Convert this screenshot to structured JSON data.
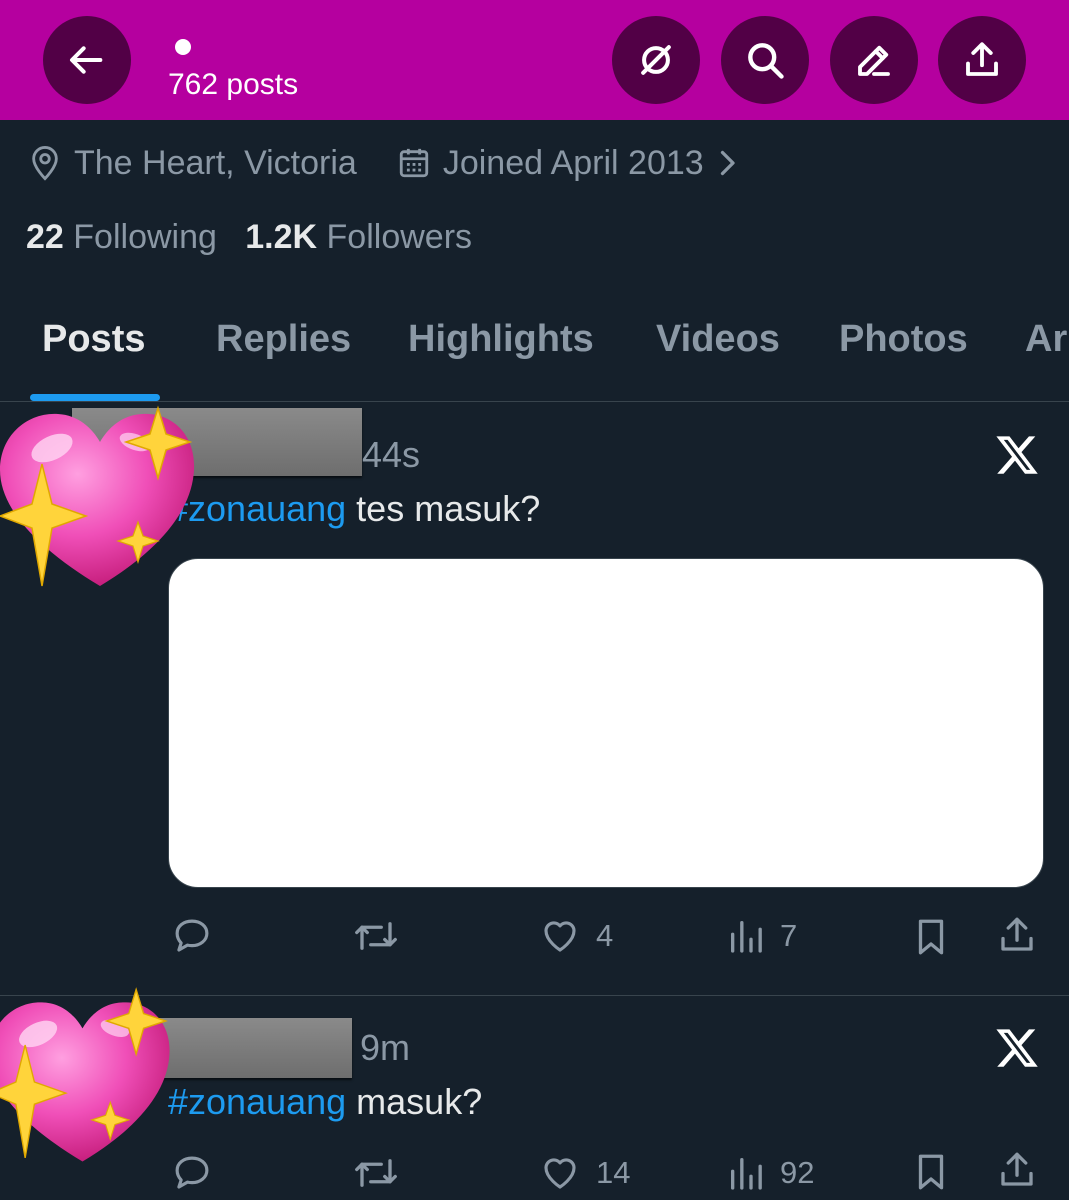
{
  "header": {
    "post_count": "762 posts",
    "icons": [
      "back-arrow-icon",
      "grok-icon",
      "search-icon",
      "edit-icon",
      "share-icon"
    ]
  },
  "profile": {
    "location": "The Heart, Victoria",
    "joined": "Joined April 2013",
    "following_count": "22",
    "following_label": "Following",
    "followers_count": "1.2K",
    "followers_label": "Followers"
  },
  "tabs": [
    {
      "label": "Posts",
      "active": true
    },
    {
      "label": "Replies",
      "active": false
    },
    {
      "label": "Highlights",
      "active": false
    },
    {
      "label": "Videos",
      "active": false
    },
    {
      "label": "Photos",
      "active": false
    },
    {
      "label": "Ar",
      "active": false
    }
  ],
  "posts": [
    {
      "time": "44s",
      "hashtag": "#zonauang",
      "text": " tes masuk?",
      "likes": "4",
      "views": "7"
    },
    {
      "time": "9m",
      "hashtag": "#zonauang",
      "text": " masuk?",
      "likes": "14",
      "views": "92"
    }
  ],
  "colors": {
    "header_bg": "#b5009f",
    "header_button": "#520046",
    "page_bg": "#15202b",
    "accent": "#1d9bf0",
    "muted_text": "#8b98a5"
  }
}
